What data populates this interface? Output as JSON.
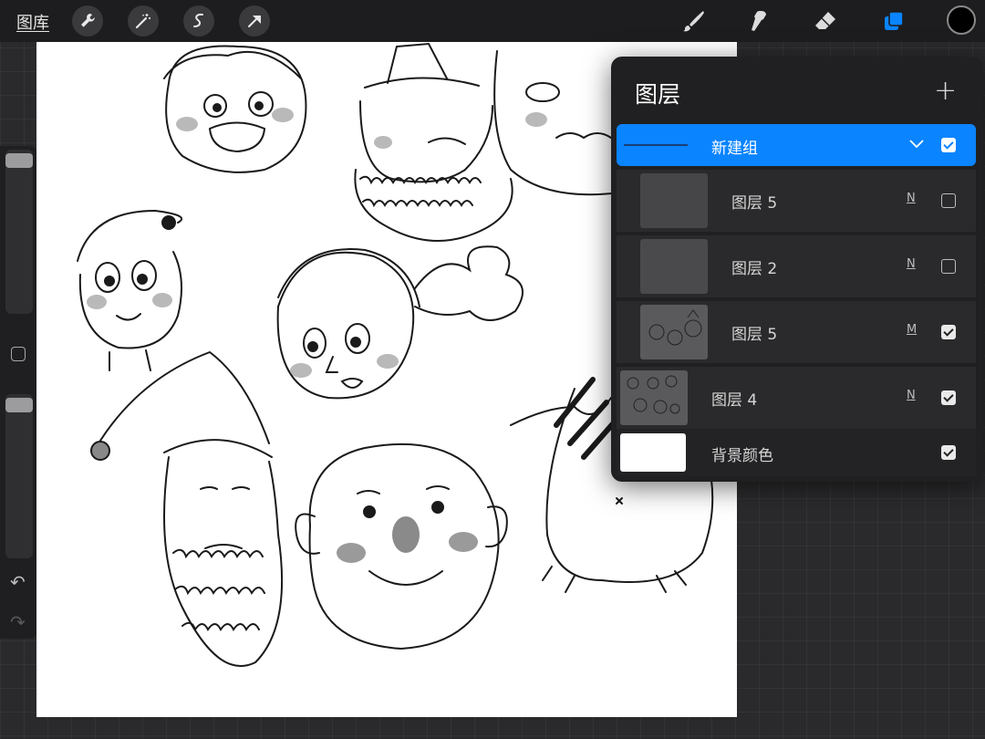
{
  "toolbar": {
    "gallery_label": "图库",
    "left_tools": [
      "wrench-icon",
      "magic-wand-icon",
      "selection-icon",
      "transform-arrow-icon"
    ],
    "right_tools": [
      "brush-icon",
      "smudge-icon",
      "eraser-icon",
      "layers-icon"
    ],
    "active_tool": "layers-icon",
    "accent_color": "#0a84ff",
    "current_color": "#000000"
  },
  "sidebar": {
    "brush_size_level": 0.98,
    "opacity_level": 0.98
  },
  "layers_panel": {
    "title": "图层",
    "add_symbol": "+",
    "group": {
      "name": "新建组",
      "expanded": true,
      "visible": true
    },
    "layers": [
      {
        "name": "图层 5",
        "blend": "N",
        "visible": false,
        "indented": true,
        "thumbnail": "blank"
      },
      {
        "name": "图层 2",
        "blend": "N",
        "visible": false,
        "indented": true,
        "thumbnail": "faint-sketch"
      },
      {
        "name": "图层 5",
        "blend": "M",
        "visible": true,
        "indented": true,
        "thumbnail": "sketch"
      },
      {
        "name": "图层 4",
        "blend": "N",
        "visible": true,
        "indented": false,
        "thumbnail": "sketch"
      }
    ],
    "background": {
      "name": "背景颜色",
      "color": "#ffffff",
      "visible": true
    }
  }
}
